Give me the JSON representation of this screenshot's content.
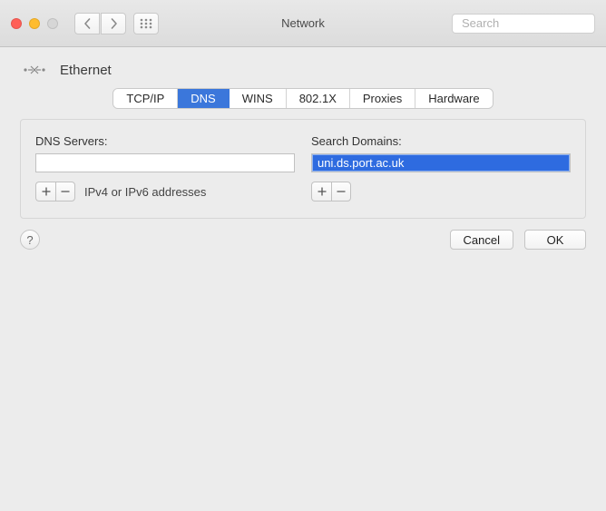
{
  "window": {
    "title": "Network",
    "search_placeholder": "Search"
  },
  "interface": {
    "name": "Ethernet"
  },
  "tabs": {
    "tcpip": "TCP/IP",
    "dns": "DNS",
    "wins": "WINS",
    "8021x": "802.1X",
    "proxies": "Proxies",
    "hardware": "Hardware",
    "active": "dns"
  },
  "dns_panel": {
    "servers_label": "DNS Servers:",
    "domains_label": "Search Domains:",
    "servers_hint": "IPv4 or IPv6 addresses",
    "search_domains": [
      {
        "value": "uni.ds.port.ac.uk",
        "selected": true
      }
    ]
  },
  "buttons": {
    "plus": "＋",
    "minus": "－",
    "help": "?",
    "cancel": "Cancel",
    "ok": "OK"
  }
}
